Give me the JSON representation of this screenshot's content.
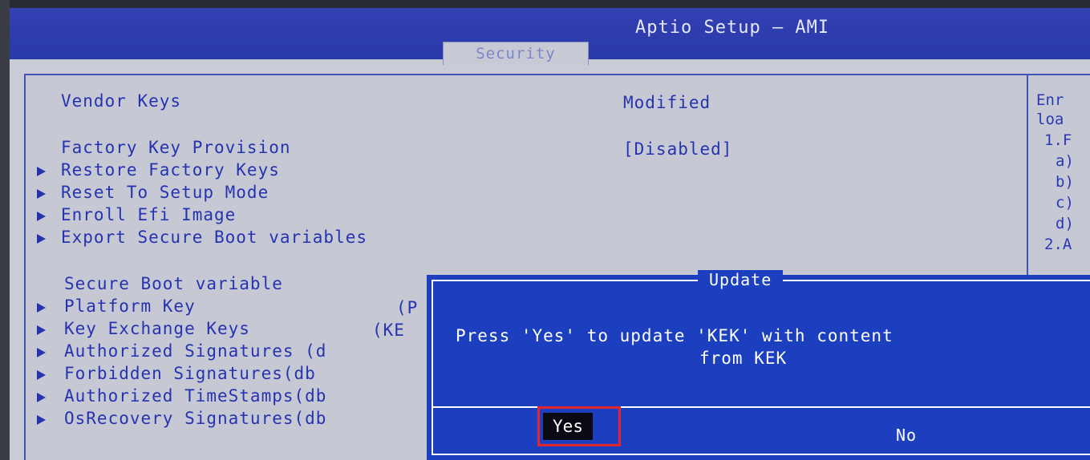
{
  "app": {
    "title": "Aptio Setup – AMI"
  },
  "tabs": [
    {
      "label": "Security",
      "active": true
    }
  ],
  "rows": [
    {
      "label": "Vendor Keys",
      "value": "Modified",
      "arrow": false
    },
    {
      "label": "Factory Key Provision",
      "value": "[Disabled]",
      "arrow": false
    },
    {
      "label": "Restore Factory Keys",
      "value": "",
      "arrow": true
    },
    {
      "label": "Reset To Setup Mode",
      "value": "",
      "arrow": true
    },
    {
      "label": "Enroll Efi Image",
      "value": "",
      "arrow": true
    },
    {
      "label": "Export Secure Boot variables",
      "value": "",
      "arrow": true
    },
    {
      "label": "Secure Boot variable",
      "value": "",
      "arrow": false
    },
    {
      "label": "Platform Key",
      "value": "(P",
      "arrow": true
    },
    {
      "label": "Key Exchange Keys",
      "value": "(KE",
      "arrow": true
    },
    {
      "label": "Authorized Signatures (d",
      "value": "",
      "arrow": true
    },
    {
      "label": "Forbidden  Signatures(db",
      "value": "",
      "arrow": true
    },
    {
      "label": "Authorized TimeStamps(db",
      "value": "",
      "arrow": true
    },
    {
      "label": "OsRecovery Signatures(db",
      "value": "",
      "arrow": true
    }
  ],
  "help": {
    "lines": [
      "Enr",
      "loa",
      "1.F",
      "a)",
      "b)",
      "c)",
      "d)",
      "2.A"
    ]
  },
  "dialog": {
    "title": "Update",
    "message_line1": "Press 'Yes' to update 'KEK' with content",
    "message_line2": "from KEK",
    "yes_label": "Yes",
    "no_label": "No",
    "selected": "Yes"
  },
  "colors": {
    "header": "#2a39a8",
    "text_blue": "#2633b0",
    "dialog_bg": "#1b3fbf",
    "highlight": "#e3262c"
  }
}
